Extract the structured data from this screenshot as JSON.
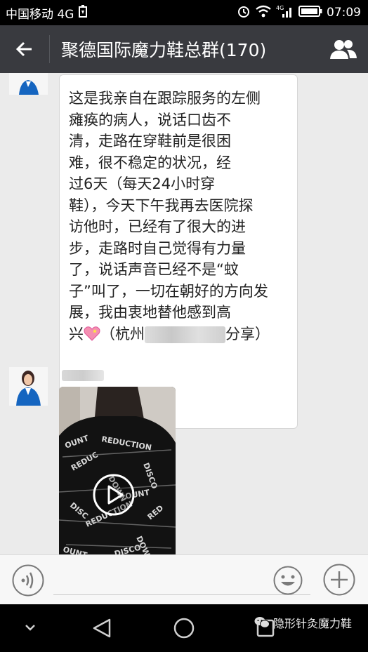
{
  "status_bar": {
    "carrier": "中国移动 4G",
    "time": "07:09"
  },
  "header": {
    "title": "聚德国际魔力鞋总群(170)"
  },
  "messages": [
    {
      "type": "text",
      "lines": [
        "这是我亲自在跟踪服务的左侧",
        "瘫痪的病人，说话口齿不",
        "清，走路在穿鞋前是很困",
        "难，很不稳定的状况，经",
        "过6天（每天24小时穿",
        "鞋），今天下午我再去医院探",
        "访他时，已经有了很大的进",
        "步，走路时自己觉得有力量",
        "了，说话声音已经不是“蚊",
        "子”叫了，一切在朝好的方向发",
        "展，我由衷地替他感到高"
      ],
      "last_line_start": "兴",
      "last_line_mid": "（杭州",
      "last_line_end": "分享）"
    },
    {
      "type": "video"
    }
  ],
  "watermark": "隐形针灸魔力鞋"
}
